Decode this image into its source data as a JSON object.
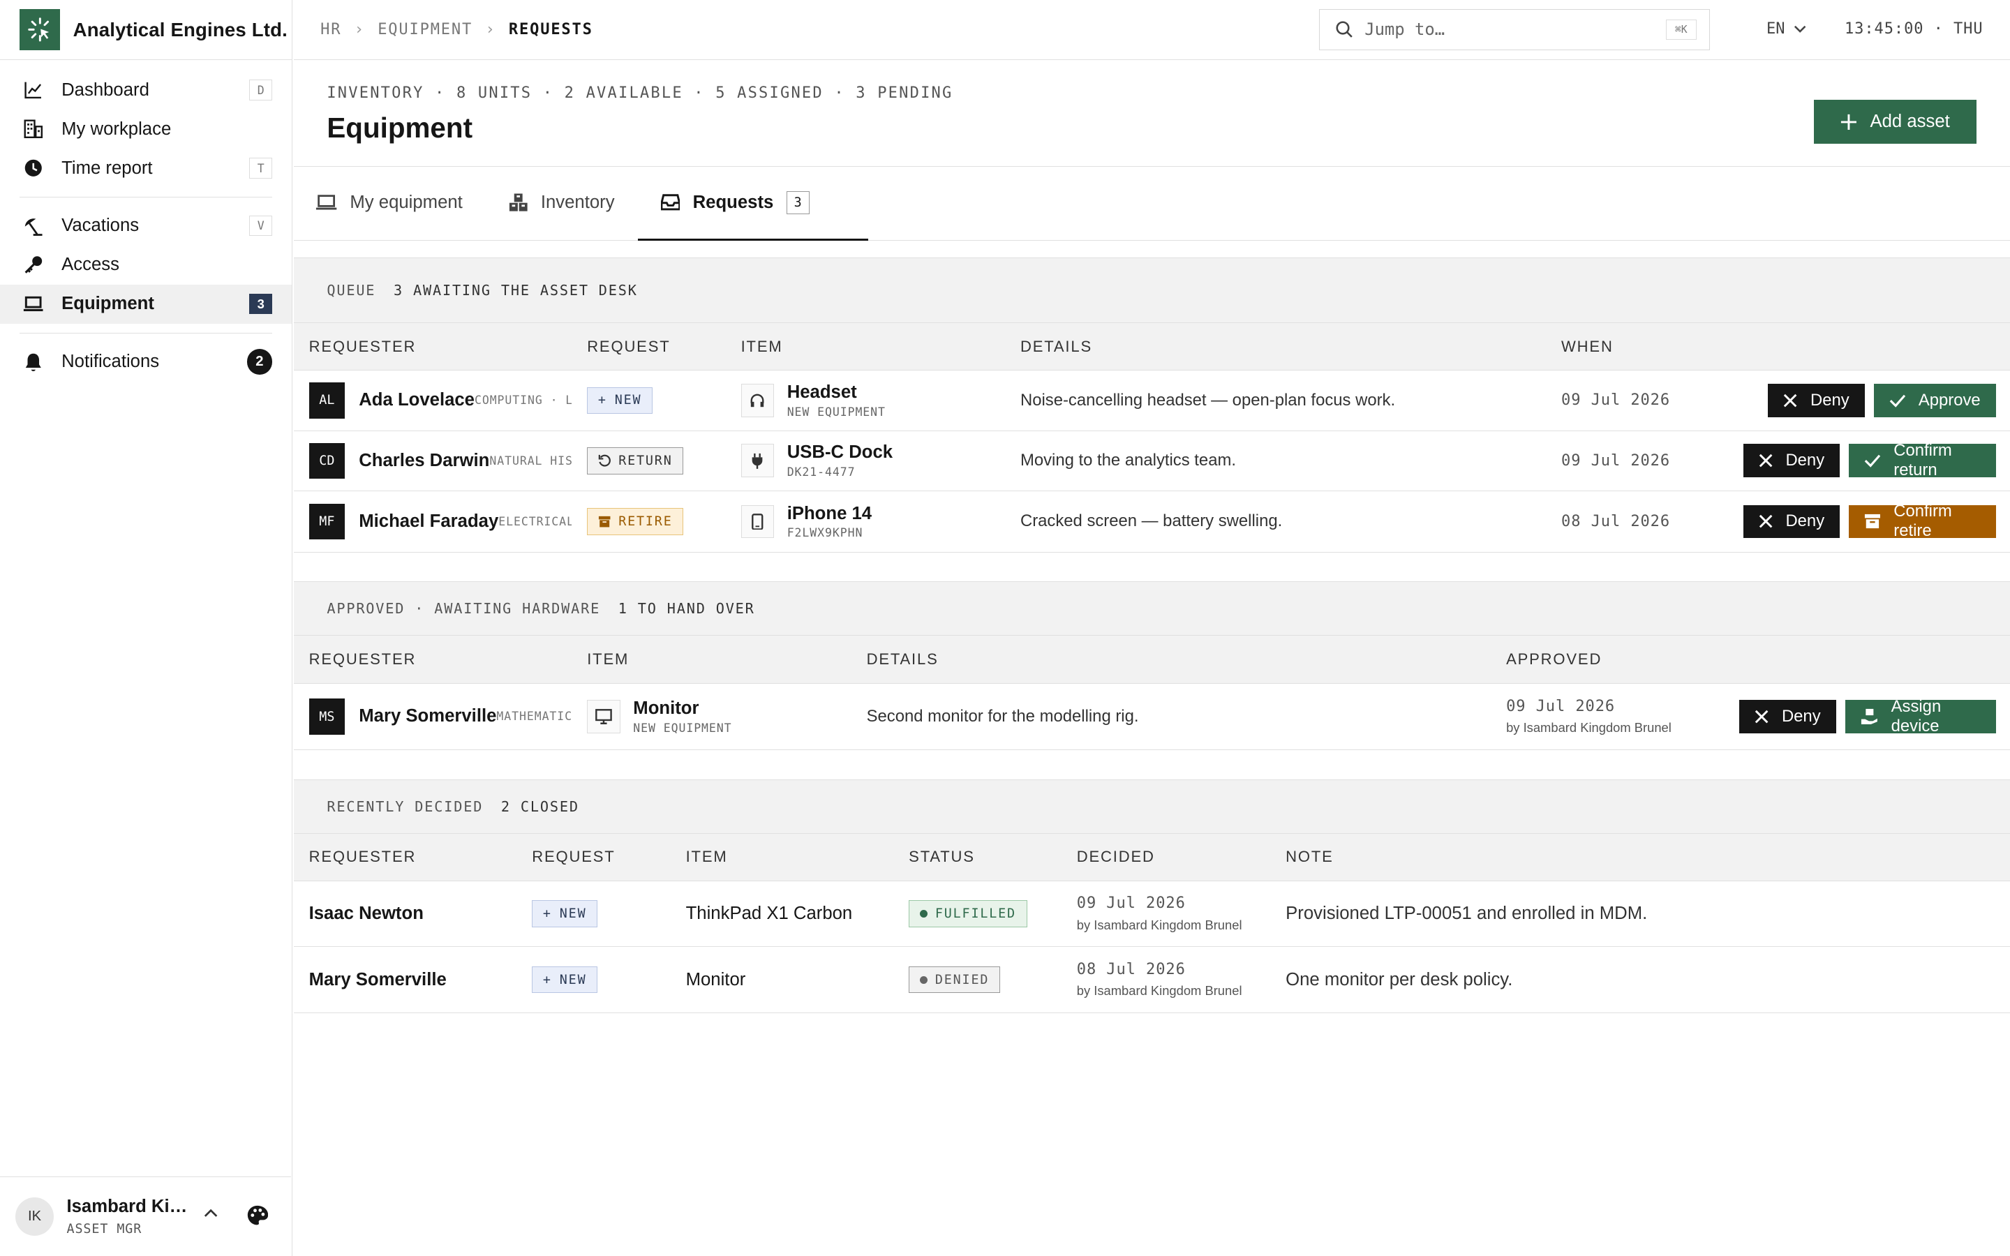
{
  "brand": {
    "name": "Analytical Engines Ltd."
  },
  "sidebar": {
    "group1": [
      {
        "label": "Dashboard",
        "icon": "chart-line-icon",
        "kbd": "D"
      },
      {
        "label": "My workplace",
        "icon": "building-icon",
        "kbd": ""
      },
      {
        "label": "Time report",
        "icon": "clock-icon",
        "kbd": "T"
      }
    ],
    "group2": [
      {
        "label": "Vacations",
        "icon": "beach-umbrella-icon",
        "kbd": "V"
      },
      {
        "label": "Access",
        "icon": "key-icon",
        "kbd": ""
      },
      {
        "label": "Equipment",
        "icon": "laptop-icon",
        "count": "3",
        "active": true
      }
    ],
    "group3": [
      {
        "label": "Notifications",
        "icon": "bell-icon",
        "badge": "2"
      }
    ]
  },
  "user": {
    "initials": "IK",
    "name": "Isambard Ki…",
    "role": "ASSET MGR"
  },
  "topbar": {
    "crumbs": [
      "HR",
      "EQUIPMENT",
      "REQUESTS"
    ],
    "search_placeholder": "Jump to…",
    "search_kbd": "⌘K",
    "lang": "EN",
    "clock": "13:45:00 · THU"
  },
  "header": {
    "meta": "INVENTORY · 8 UNITS · 2 AVAILABLE · 5 ASSIGNED · 3 PENDING",
    "title": "Equipment",
    "add_label": "Add asset"
  },
  "tabs": [
    {
      "label": "My equipment"
    },
    {
      "label": "Inventory"
    },
    {
      "label": "Requests",
      "count": "3"
    }
  ],
  "queue": {
    "label": "QUEUE",
    "sub": "3 AWAITING THE ASSET DESK",
    "headers": [
      "REQUESTER",
      "REQUEST",
      "ITEM",
      "DETAILS",
      "WHEN"
    ],
    "rows": [
      {
        "initials": "AL",
        "name": "Ada Lovelace",
        "dept": "COMPUTING · L",
        "request": "NEW",
        "item": "Headset",
        "item_sub": "NEW EQUIPMENT",
        "details": "Noise-cancelling headset — open-plan focus work.",
        "when": "09 Jul 2026",
        "deny": "Deny",
        "action": "Approve"
      },
      {
        "initials": "CD",
        "name": "Charles Darwin",
        "dept": "NATURAL HIS",
        "request": "RETURN",
        "item": "USB-C Dock",
        "item_sub": "DK21-4477",
        "details": "Moving to the analytics team.",
        "when": "09 Jul 2026",
        "deny": "Deny",
        "action": "Confirm return"
      },
      {
        "initials": "MF",
        "name": "Michael Faraday",
        "dept": "ELECTRICAL",
        "request": "RETIRE",
        "item": "iPhone 14",
        "item_sub": "F2LWX9KPHN",
        "details": "Cracked screen — battery swelling.",
        "when": "08 Jul 2026",
        "deny": "Deny",
        "action": "Confirm retire"
      }
    ]
  },
  "approved": {
    "label": "APPROVED · AWAITING HARDWARE",
    "sub": "1 TO HAND OVER",
    "headers": [
      "REQUESTER",
      "ITEM",
      "DETAILS",
      "APPROVED"
    ],
    "rows": [
      {
        "initials": "MS",
        "name": "Mary Somerville",
        "dept": "MATHEMATIC",
        "item": "Monitor",
        "item_sub": "NEW EQUIPMENT",
        "details": "Second monitor for the modelling rig.",
        "approved": "09 Jul 2026",
        "by": "by Isambard Kingdom Brunel",
        "deny": "Deny",
        "action": "Assign device"
      }
    ]
  },
  "decided": {
    "label": "RECENTLY DECIDED",
    "sub": "2 CLOSED",
    "headers": [
      "REQUESTER",
      "REQUEST",
      "ITEM",
      "STATUS",
      "DECIDED",
      "NOTE"
    ],
    "rows": [
      {
        "name": "Isaac Newton",
        "request": "NEW",
        "item": "ThinkPad X1 Carbon",
        "status": "FULFILLED",
        "decided": "09 Jul 2026",
        "by": "by Isambard Kingdom Brunel",
        "note": "Provisioned LTP-00051 and enrolled in MDM."
      },
      {
        "name": "Mary Somerville",
        "request": "NEW",
        "item": "Monitor",
        "status": "DENIED",
        "decided": "08 Jul 2026",
        "by": "by Isambard Kingdom Brunel",
        "note": "One monitor per desk policy."
      }
    ]
  },
  "colors": {
    "accent": "#2f6a4b",
    "retire": "#a55c00",
    "nav_count": "#2b3a55"
  }
}
